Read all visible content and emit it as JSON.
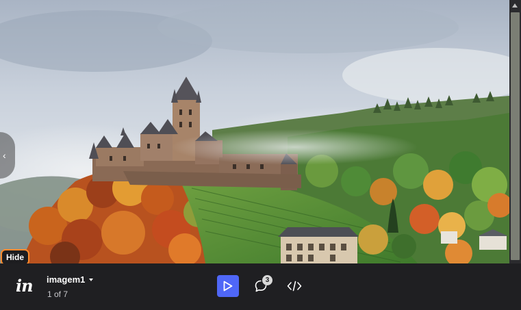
{
  "prototype": {
    "image_alt": "Castle on a hilltop surrounded by autumn forest and mist",
    "hide_label": "Hide"
  },
  "toolbar": {
    "logo_text": "in",
    "screen_title": "imagem1",
    "screen_counter": "1 of 7",
    "comment_count": "3",
    "accent_color": "#4f67f7",
    "highlight_color": "#ff8a2b"
  },
  "icons": {
    "logo": "invision-logo-icon",
    "caret": "chevron-down-icon",
    "play": "play-icon",
    "comment": "comment-icon",
    "code": "code-icon",
    "prev": "chevron-left-icon",
    "next": "chevron-right-icon"
  }
}
